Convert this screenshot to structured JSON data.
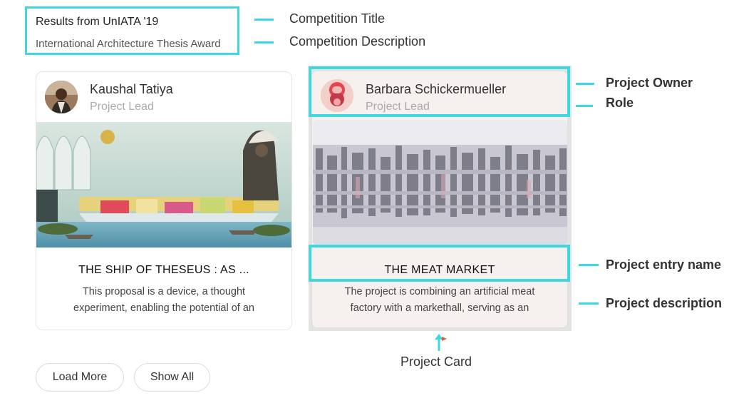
{
  "competition": {
    "title": "Results from UnIATA '19",
    "description": "International Architecture Thesis Award"
  },
  "cards": [
    {
      "owner_name": "Kaushal Tatiya",
      "owner_role": "Project Lead",
      "title": "THE SHIP OF THESEUS : AS ...",
      "description_line1": "This proposal is a device, a thought",
      "description_line2": "experiment, enabling the potential of an"
    },
    {
      "owner_name": "Barbara Schickermueller",
      "owner_role": "Project Lead",
      "title": "THE MEAT MARKET",
      "description_line1": "The project is combining an artificial meat",
      "description_line2": "factory with a markethall, serving as an"
    }
  ],
  "buttons": {
    "load_more": "Load More",
    "show_all": "Show All"
  },
  "annotations": {
    "competition_title": "Competition Title",
    "competition_description": "Competition Description",
    "project_owner": "Project Owner",
    "role": "Role",
    "project_entry_name": "Project entry name",
    "project_description": "Project description",
    "project_card": "Project Card"
  },
  "colors": {
    "accent": "#3fd8e0",
    "arrow_tip": "#e8553a"
  }
}
